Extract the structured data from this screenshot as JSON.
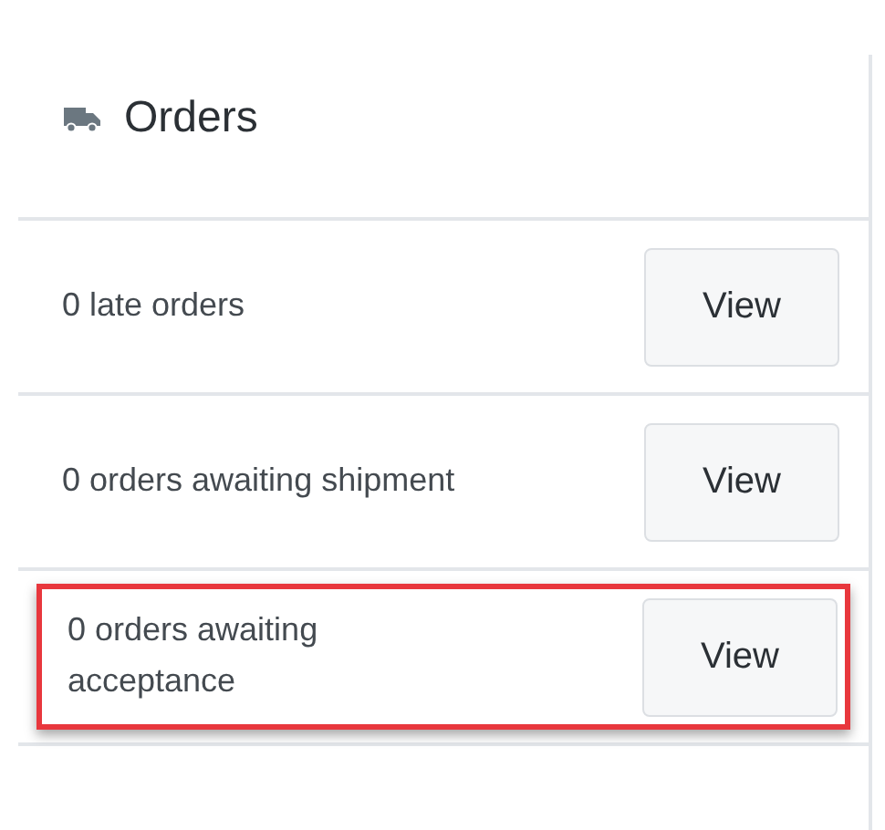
{
  "card": {
    "title": "Orders",
    "rows": [
      {
        "text": "0 late orders",
        "button": "View",
        "highlighted": false
      },
      {
        "text": "0 orders awaiting shipment",
        "button": "View",
        "highlighted": false
      },
      {
        "text": "0 orders awaiting acceptance",
        "button": "View",
        "highlighted": true
      }
    ]
  }
}
